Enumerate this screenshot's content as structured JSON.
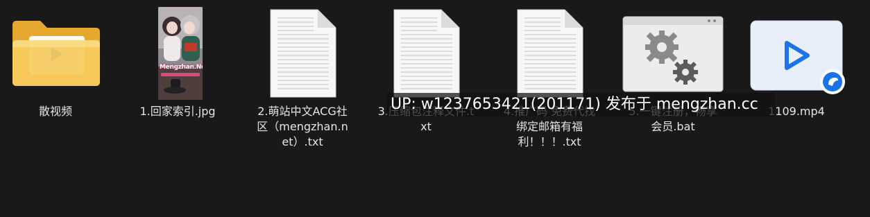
{
  "files": [
    {
      "label": "散视频",
      "icon": "folder-icon"
    },
    {
      "label": "1.回家索引.jpg",
      "icon": "image-thumbnail",
      "thumb_brand": "Mengzhan.Net"
    },
    {
      "label": "2.萌站中文ACG社区（mengzhan.net）.txt",
      "icon": "text-file-icon"
    },
    {
      "label": "3.压缩包注释文件.txt",
      "icon": "text-file-icon"
    },
    {
      "label": "4.推广码 免费代找 绑定邮箱有福利！！！.txt",
      "icon": "text-file-icon"
    },
    {
      "label": "5.一键注册，畅享会员.bat",
      "icon": "batch-file-icon"
    },
    {
      "label": "1109.mp4",
      "icon": "video-file-icon"
    }
  ],
  "watermark": "UP: w1237653421(201171) 发布于 mengzhan.cc",
  "colors": {
    "background": "#191919",
    "folder": "#f3c24f",
    "video_accent": "#1a73e8"
  }
}
